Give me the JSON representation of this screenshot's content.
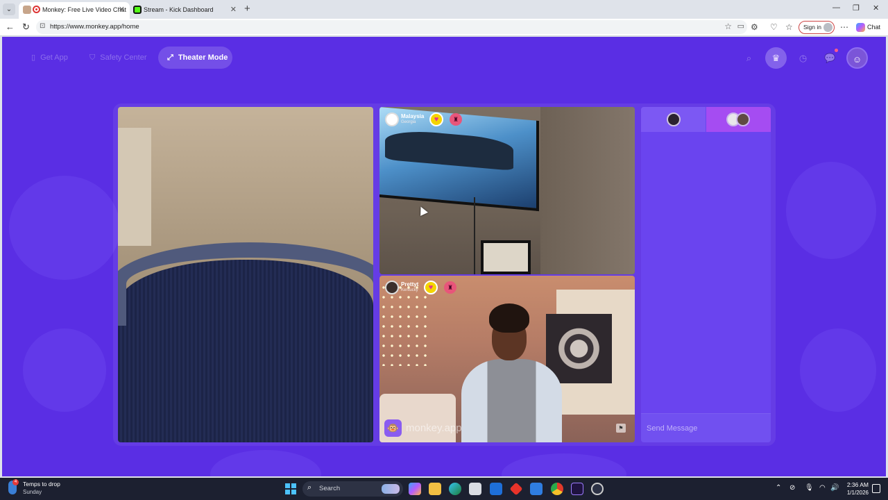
{
  "browser": {
    "tabs": [
      {
        "title": "Monkey: Free Live Video Chat",
        "active": true
      },
      {
        "title": "Stream - Kick Dashboard",
        "active": false
      }
    ],
    "new_tab_icon": "plus-icon",
    "url": "https://www.monkey.app/home",
    "sign_in_label": "Sign in",
    "chat_label": "Chat"
  },
  "header": {
    "get_app_label": "Get App",
    "safety_center_label": "Safety Center",
    "theater_mode_label": "Theater Mode"
  },
  "videos": {
    "top": {
      "name": "Malaysia",
      "location": "Georgia"
    },
    "bottom": {
      "name": "Prettyt",
      "location": "Kentucky"
    }
  },
  "watermark": {
    "text": "monkey.app"
  },
  "chat": {
    "input_placeholder": "Send Message"
  },
  "taskbar": {
    "weather_title": "Temps to drop",
    "weather_sub": "Sunday",
    "weather_badge": "4",
    "search_placeholder": "Search",
    "time": "2:36 AM",
    "date": "1/1/2026"
  },
  "colors": {
    "page_bg": "#5a2ee4",
    "chat_tab_active": "#a54cf2",
    "heart_badge": "#f5d400",
    "accent_pink": "#e8557a"
  }
}
